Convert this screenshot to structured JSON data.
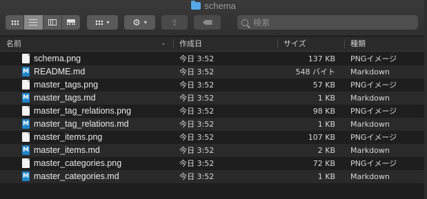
{
  "window": {
    "title": "schema",
    "title_icon": "folder-icon"
  },
  "toolbar": {
    "view_modes": [
      "icon-view-icon",
      "list-view-icon",
      "column-view-icon",
      "gallery-view-icon"
    ],
    "active_view": "list-view-icon",
    "group_icon": "group-grid-icon",
    "action_icon": "gear-icon",
    "share_icon": "share-icon",
    "tag_icon": "tag-icon",
    "chevron": "▾",
    "share_glyph": "⇪",
    "search_placeholder": "検索"
  },
  "header": {
    "name": "名前",
    "date": "作成日",
    "size": "サイズ",
    "kind": "種類",
    "sort_indicator": "⌄"
  },
  "files": [
    {
      "name": "schema.png",
      "date": "今日 3:52",
      "size": "137 KB",
      "kind": "PNGイメージ",
      "type": "png"
    },
    {
      "name": "README.md",
      "date": "今日 3:52",
      "size": "548 バイト",
      "kind": "Markdown",
      "type": "md"
    },
    {
      "name": "master_tags.png",
      "date": "今日 3:52",
      "size": "57 KB",
      "kind": "PNGイメージ",
      "type": "png"
    },
    {
      "name": "master_tags.md",
      "date": "今日 3:52",
      "size": "1 KB",
      "kind": "Markdown",
      "type": "md"
    },
    {
      "name": "master_tag_relations.png",
      "date": "今日 3:52",
      "size": "98 KB",
      "kind": "PNGイメージ",
      "type": "png"
    },
    {
      "name": "master_tag_relations.md",
      "date": "今日 3:52",
      "size": "1 KB",
      "kind": "Markdown",
      "type": "md"
    },
    {
      "name": "master_items.png",
      "date": "今日 3:52",
      "size": "107 KB",
      "kind": "PNGイメージ",
      "type": "png"
    },
    {
      "name": "master_items.md",
      "date": "今日 3:52",
      "size": "2 KB",
      "kind": "Markdown",
      "type": "md"
    },
    {
      "name": "master_categories.png",
      "date": "今日 3:52",
      "size": "72 KB",
      "kind": "PNGイメージ",
      "type": "png"
    },
    {
      "name": "master_categories.md",
      "date": "今日 3:52",
      "size": "1 KB",
      "kind": "Markdown",
      "type": "md"
    }
  ],
  "md_icon_glyph": "M"
}
